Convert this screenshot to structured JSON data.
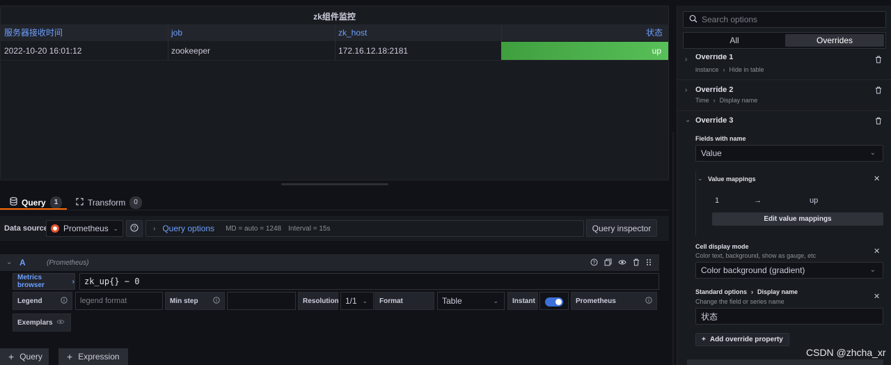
{
  "panel": {
    "title": "zk组件监控",
    "columns": [
      "服务器接收时间",
      "job",
      "zk_host",
      "状态"
    ],
    "row": [
      "2022-10-20 16:01:12",
      "zookeeper",
      "172.16.12.18:2181",
      "up"
    ]
  },
  "tabs": {
    "query": {
      "label": "Query",
      "count": "1"
    },
    "transform": {
      "label": "Transform",
      "count": "0"
    }
  },
  "toolbar": {
    "datasource_label": "Data source",
    "datasource_value": "Prometheus",
    "query_options": "Query options",
    "md": "MD = auto = 1248",
    "interval": "Interval = 15s",
    "query_inspector": "Query inspector"
  },
  "query": {
    "ref": "A",
    "ds": "(Prometheus)",
    "metrics_browser": "Metrics browser",
    "expr": "zk_up{} − 0",
    "legend_label": "Legend",
    "legend_placeholder": "legend format",
    "min_step_label": "Min step",
    "resolution_label": "Resolution",
    "resolution_value": "1/1",
    "format_label": "Format",
    "format_value": "Table",
    "instant_label": "Instant",
    "instant_on": true,
    "prometheus_label": "Prometheus",
    "exemplars_label": "Exemplars"
  },
  "bottom": {
    "add_query": "Query",
    "add_expression": "Expression"
  },
  "options": {
    "search_placeholder": "Search options",
    "seg_all": "All",
    "seg_overrides": "Overrides",
    "override1": {
      "title": "Override 1",
      "a": "instance",
      "b": "Hide in table"
    },
    "override2": {
      "title": "Override 2",
      "a": "Time",
      "b": "Display name"
    },
    "override3": {
      "title": "Override 3"
    },
    "fields_with_name_label": "Fields with name",
    "fields_with_name_value": "Value",
    "value_mappings_label": "Value mappings",
    "mapping_from": "1",
    "mapping_to": "up",
    "edit_mappings": "Edit value mappings",
    "cell_display_label": "Cell display mode",
    "cell_display_desc": "Color text, background, show as gauge, etc",
    "cell_display_value": "Color background (gradient)",
    "standard_options": "Standard options",
    "display_name": "Display name",
    "display_name_desc": "Change the field or series name",
    "display_name_value": "状态",
    "add_override": "Add override property"
  },
  "watermark": "CSDN @zhcha_xr",
  "colors": {
    "accent": "#ff6a00",
    "link": "#6e9fff",
    "status_up": "#56b856",
    "toggle": "#3d71d9"
  }
}
